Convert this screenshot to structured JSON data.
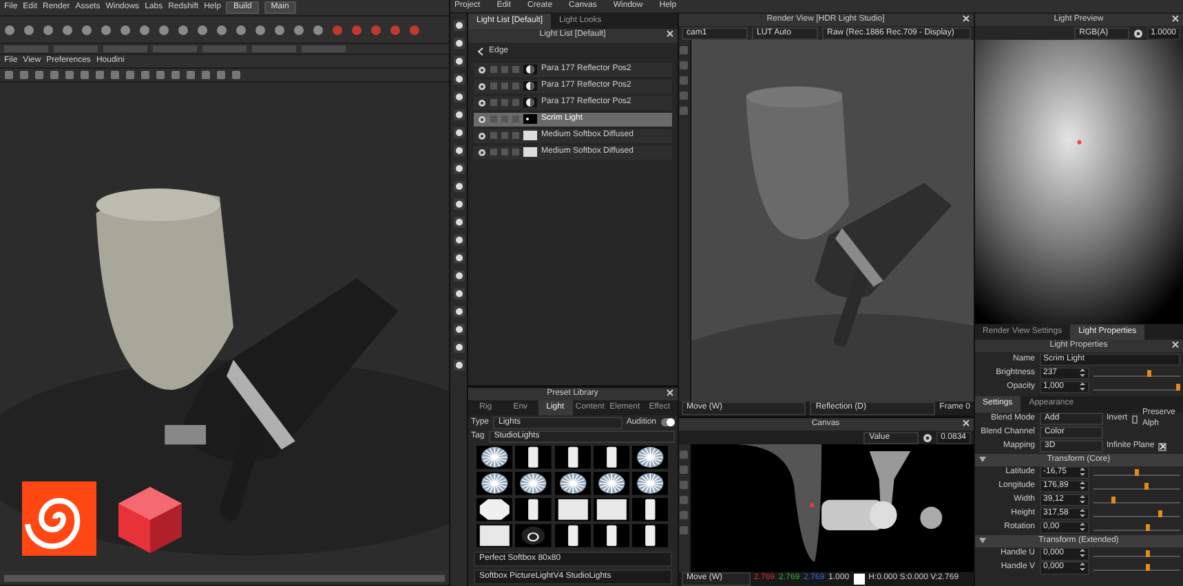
{
  "houdini": {
    "menu": [
      "File",
      "Edit",
      "Render",
      "Assets",
      "Windows",
      "Labs",
      "Redshift",
      "Help"
    ],
    "desktop": "Build",
    "pane": "Main",
    "viewport_menu": [
      "File",
      "View",
      "Preferences",
      "Houdini"
    ],
    "logos": [
      {
        "kind": "houdini"
      },
      {
        "kind": "redshift"
      }
    ]
  },
  "hdrls": {
    "menu": [
      "Project",
      "Edit",
      "Create",
      "Canvas",
      "Window",
      "Help"
    ]
  },
  "light_list": {
    "tabs": [
      {
        "label": "Light List [Default]",
        "selected": true
      },
      {
        "label": "Light Looks",
        "selected": false
      }
    ],
    "title": "Light List [Default]",
    "group": "Edge",
    "lights": [
      {
        "name": "Para 177 Reflector Pos2",
        "kind": "round",
        "selected": false
      },
      {
        "name": "Para 177 Reflector Pos2",
        "kind": "round",
        "selected": false
      },
      {
        "name": "Para 177 Reflector Pos2",
        "kind": "round",
        "selected": false
      },
      {
        "name": "Scrim Light",
        "kind": "dot",
        "selected": true
      },
      {
        "name": "Medium Softbox Diffused",
        "kind": "flat",
        "selected": false
      },
      {
        "name": "Medium Softbox Diffused",
        "kind": "flat",
        "selected": false
      }
    ]
  },
  "preset_library": {
    "title": "Preset Library",
    "tabs": [
      {
        "label": "Rig",
        "selected": false
      },
      {
        "label": "Env",
        "selected": false
      },
      {
        "label": "Light",
        "selected": true
      },
      {
        "label": "Content",
        "selected": false
      },
      {
        "label": "Element",
        "selected": false
      },
      {
        "label": "Effect",
        "selected": false
      }
    ],
    "type_label": "Type",
    "type": "Lights",
    "audition_label": "Audition",
    "audition": true,
    "tag_label": "Tag",
    "tag": "StudioLights",
    "presets": [
      {
        "kind": "burst"
      },
      {
        "kind": "strip"
      },
      {
        "kind": "strip"
      },
      {
        "kind": "strip"
      },
      {
        "kind": "burst"
      },
      {
        "kind": "burst"
      },
      {
        "kind": "burst"
      },
      {
        "kind": "burst"
      },
      {
        "kind": "burst"
      },
      {
        "kind": "burst"
      },
      {
        "kind": "octagon"
      },
      {
        "kind": "strip"
      },
      {
        "kind": "rect"
      },
      {
        "kind": "rect"
      },
      {
        "kind": "strip"
      },
      {
        "kind": "rect"
      },
      {
        "kind": "ring"
      },
      {
        "kind": "strip"
      },
      {
        "kind": "strip"
      },
      {
        "kind": "strip"
      }
    ],
    "items": [
      "Perfect Softbox 80x80",
      "Softbox PictureLightV4 StudioLights"
    ]
  },
  "render_view": {
    "title": "Render View [HDR Light Studio]",
    "camera": "cam1",
    "lut": "LUT Auto",
    "display": "Raw (Rec.1886 Rec.709 - Display)",
    "tool": "Move (W)",
    "mode": "Reflection (D)",
    "frame": "Frame 0"
  },
  "canvas": {
    "title": "Canvas",
    "channel": "Value",
    "value": "0.0834",
    "tool": "Move (W)",
    "readout": [
      {
        "text": "2.769",
        "color": "#d03030"
      },
      {
        "text": "2.769",
        "color": "#30b030"
      },
      {
        "text": "2.769",
        "color": "#4060e0"
      }
    ],
    "alpha": "1.000",
    "hsv": "H:0.000 S:0.000 V:2.769"
  },
  "light_preview": {
    "title": "Light Preview",
    "channel": "RGB(A)",
    "value": "1.0000"
  },
  "light_properties": {
    "tabs": [
      {
        "label": "Render View Settings",
        "selected": false
      },
      {
        "label": "Light Properties",
        "selected": true
      }
    ],
    "title": "Light Properties",
    "fields": [
      {
        "label": "Name",
        "value": "Scrim Light",
        "kind": "text"
      },
      {
        "label": "Brightness",
        "value": "237",
        "kind": "slider",
        "level": 0.65
      },
      {
        "label": "Opacity",
        "value": "1,000",
        "kind": "slider",
        "level": 1
      }
    ],
    "subtabs": [
      {
        "label": "Settings",
        "selected": true
      },
      {
        "label": "Appearance",
        "selected": false
      }
    ],
    "options": [
      {
        "label": "Blend Mode",
        "value": "Add",
        "check_label": "Invert",
        "checked": false,
        "extra": "Preserve Alph"
      },
      {
        "label": "Blend Channel",
        "value": "Color"
      },
      {
        "label": "Mapping",
        "value": "3D",
        "check_label": "Infinite Plane",
        "checked": true
      }
    ],
    "sections": [
      {
        "title": "Transform (Core)",
        "expanded": true,
        "fields": [
          {
            "label": "Latitude",
            "value": "-16,75",
            "level": 0.5
          },
          {
            "label": "Longitude",
            "value": "176,89",
            "level": 0.62
          },
          {
            "label": "Width",
            "value": "39,12",
            "level": 0.22
          },
          {
            "label": "Height",
            "value": "317,58",
            "level": 0.78
          },
          {
            "label": "Rotation",
            "value": "0,00",
            "level": 0.63
          }
        ]
      },
      {
        "title": "Transform (Extended)",
        "expanded": true,
        "fields": [
          {
            "label": "Handle U",
            "value": "0,000",
            "level": 0.63
          },
          {
            "label": "Handle V",
            "value": "0,000",
            "level": 0.63
          }
        ]
      }
    ]
  }
}
